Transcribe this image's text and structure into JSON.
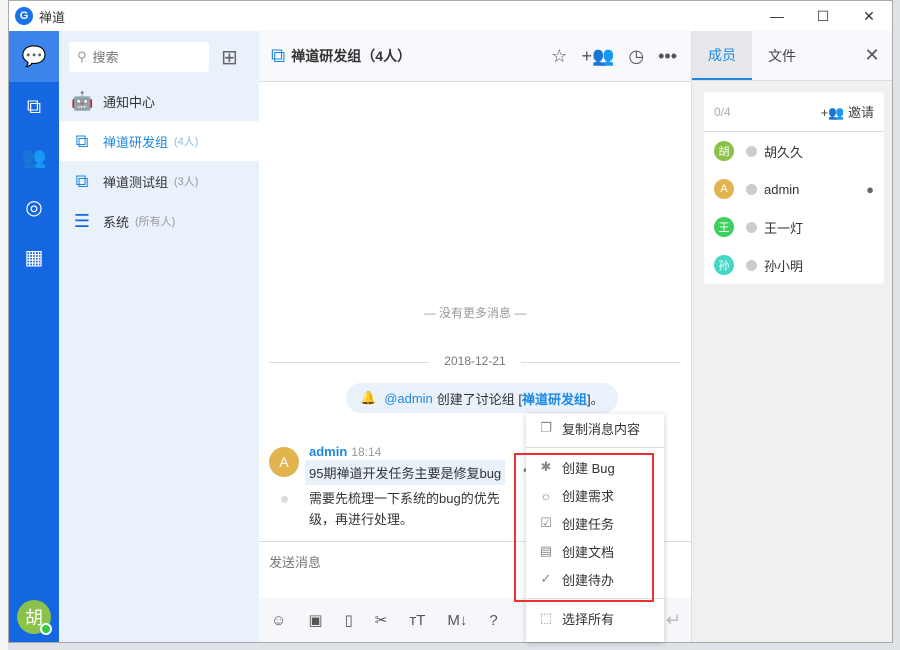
{
  "window": {
    "title": "禅道",
    "controls": [
      "—",
      "☐",
      "✕"
    ]
  },
  "nav": {
    "items": [
      {
        "icon": "chat-icon",
        "glyph": "💬"
      },
      {
        "icon": "groups-icon",
        "glyph": "⧉"
      },
      {
        "icon": "contacts-icon",
        "glyph": "👥"
      },
      {
        "icon": "zentao-icon",
        "glyph": "◎"
      },
      {
        "icon": "apps-icon",
        "glyph": "▦"
      }
    ],
    "me_avatar": "胡"
  },
  "list": {
    "search_placeholder": "搜索",
    "chats": [
      {
        "name": "通知中心",
        "count": "",
        "icon": "robot-icon",
        "glyph": "🤖",
        "color": "#ff1f5a"
      },
      {
        "name": "禅道研发组",
        "count": "(4人)",
        "icon": "group-chat-icon",
        "glyph": "⧉",
        "active": true
      },
      {
        "name": "禅道测试组",
        "count": "(3人)",
        "icon": "group-chat-icon",
        "glyph": "⧉"
      },
      {
        "name": "系统",
        "count": "(所有人)",
        "icon": "system-icon",
        "glyph": "☰"
      }
    ]
  },
  "main": {
    "title": "禅道研发组（4人）",
    "no_more": "— 没有更多消息 —",
    "date": "2018-12-21",
    "notice": {
      "at": "@admin",
      "text": "创建了讨论组 [",
      "group": "禅道研发组",
      "end": "]。"
    },
    "message": {
      "author": "admin",
      "avatar": "A",
      "time": "18:14",
      "line1": "95期禅道开发任务主要是修复bug",
      "line2": "需要先梳理一下系统的bug的优先级，再进行处理。"
    },
    "input_placeholder": "发送消息"
  },
  "menu": {
    "items": [
      {
        "label": "复制消息内容",
        "glyph": "❐"
      },
      {
        "label": "创建 Bug",
        "glyph": "✱"
      },
      {
        "label": "创建需求",
        "glyph": "☼"
      },
      {
        "label": "创建任务",
        "glyph": "☑"
      },
      {
        "label": "创建文档",
        "glyph": "▤"
      },
      {
        "label": "创建待办",
        "glyph": "✓"
      },
      {
        "label": "选择所有",
        "glyph": "⬚"
      }
    ]
  },
  "side": {
    "tabs": [
      "成员",
      "文件"
    ],
    "count": "0/4",
    "invite": "+👥 邀请",
    "members": [
      {
        "name": "胡久久",
        "avatar": "胡",
        "color": "#8bc34a"
      },
      {
        "name": "admin",
        "avatar": "A",
        "color": "#e1b44f",
        "admin": true
      },
      {
        "name": "王一灯",
        "avatar": "王",
        "color": "#3fd160"
      },
      {
        "name": "孙小明",
        "avatar": "孙",
        "color": "#44d7c4"
      }
    ]
  },
  "colors": {
    "accent": "#1e88e5",
    "nav": "#1467e0",
    "highlight": "#f03030"
  }
}
